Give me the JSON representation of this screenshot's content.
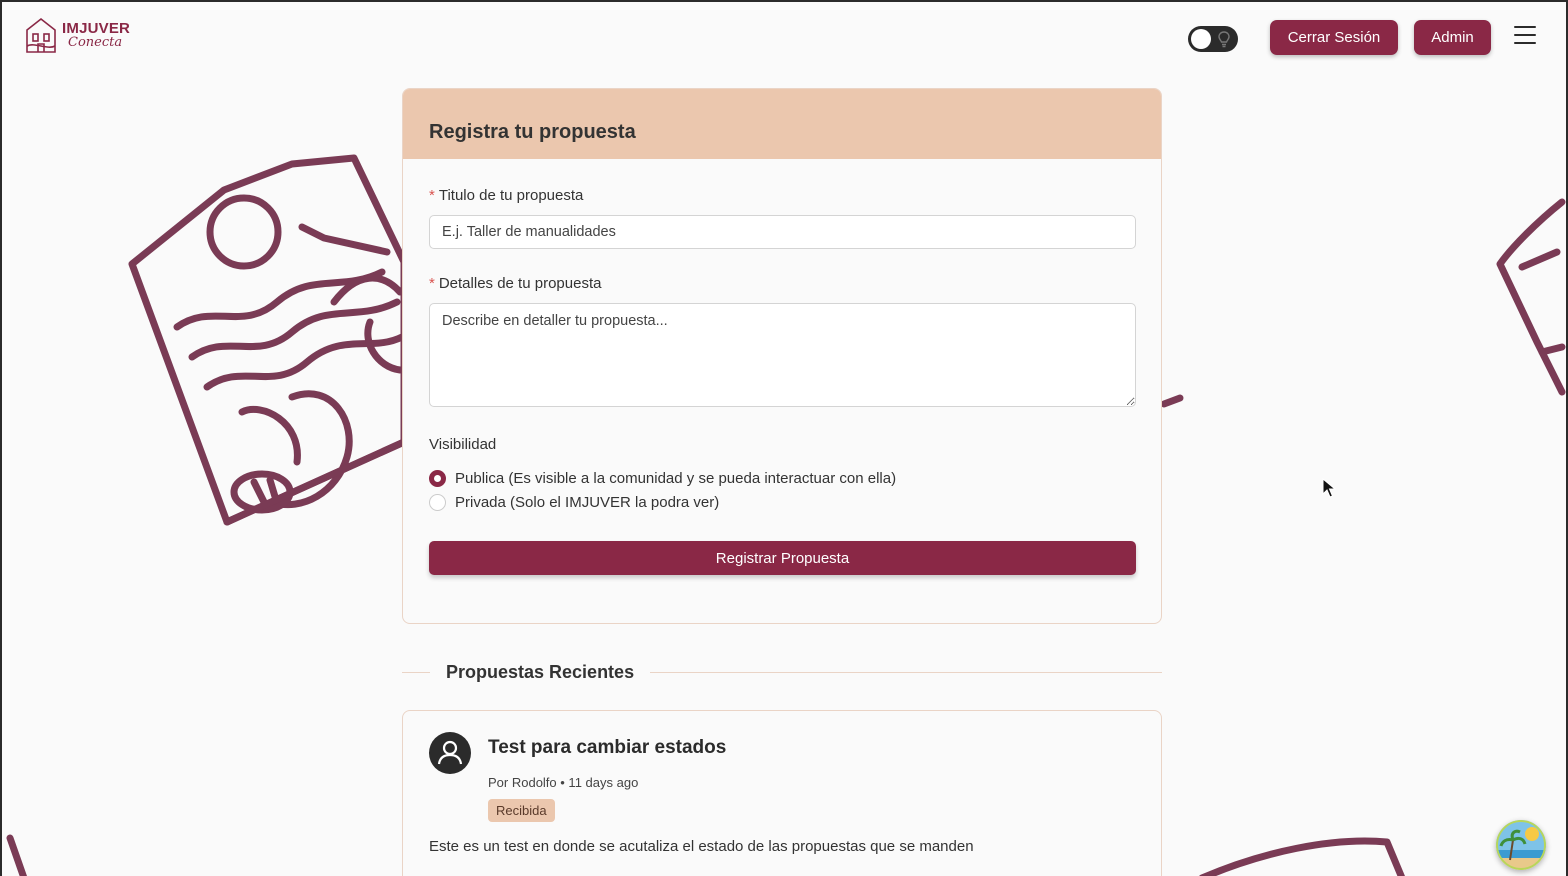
{
  "header": {
    "logo_title": "IMJUVER",
    "logo_subtitle": "Conecta",
    "logout_label": "Cerrar Sesión",
    "admin_label": "Admin"
  },
  "form": {
    "title": "Registra tu propuesta",
    "title_field": {
      "label": "Titulo de tu propuesta",
      "placeholder": "E.j. Taller de manualidades",
      "value": ""
    },
    "details_field": {
      "label": "Detalles de tu propuesta",
      "placeholder": "Describe en detaller tu propuesta...",
      "value": ""
    },
    "visibility": {
      "label": "Visibilidad",
      "options": [
        {
          "label": "Publica (Es visible a la comunidad y se pueda interactuar con ella)",
          "selected": true
        },
        {
          "label": "Privada (Solo el IMJUVER la podra ver)",
          "selected": false
        }
      ]
    },
    "submit_label": "Registrar Propuesta"
  },
  "recent": {
    "heading": "Propuestas Recientes",
    "posts": [
      {
        "title": "Test para cambiar estados",
        "meta": "Por Rodolfo • 11 days ago",
        "status": "Recibida",
        "body": "Este es un test en donde se acutaliza el estado de las propuestas que se manden"
      }
    ]
  },
  "colors": {
    "brand": "#8a2846",
    "header_peach": "#ebc7ae",
    "art_stroke": "#7a3b55"
  }
}
